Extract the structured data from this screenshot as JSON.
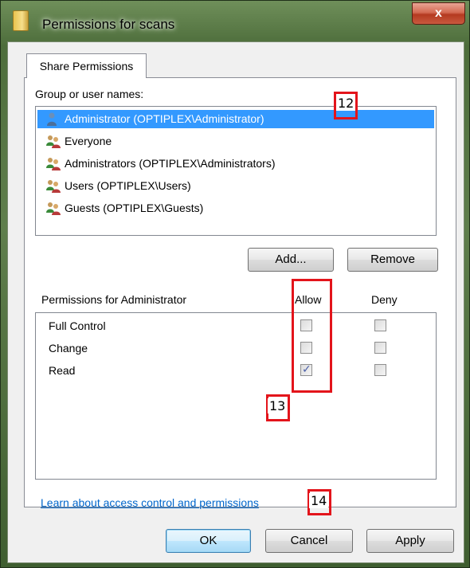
{
  "window": {
    "title": "Permissions for scans",
    "close_glyph": "x"
  },
  "tab": {
    "label": "Share Permissions"
  },
  "group_label": "Group or user names:",
  "users": [
    {
      "name": "Administrator (OPTIPLEX\\Administrator)",
      "icon": "single-user-icon",
      "selected": true
    },
    {
      "name": "Everyone",
      "icon": "user-group-icon",
      "selected": false
    },
    {
      "name": "Administrators (OPTIPLEX\\Administrators)",
      "icon": "user-group-icon",
      "selected": false
    },
    {
      "name": "Users (OPTIPLEX\\Users)",
      "icon": "user-group-icon",
      "selected": false
    },
    {
      "name": "Guests (OPTIPLEX\\Guests)",
      "icon": "user-group-icon",
      "selected": false
    }
  ],
  "buttons": {
    "add": "Add...",
    "remove": "Remove",
    "ok": "OK",
    "cancel": "Cancel",
    "apply": "Apply"
  },
  "permissions": {
    "header": "Permissions for Administrator",
    "allow_label": "Allow",
    "deny_label": "Deny",
    "rows": [
      {
        "name": "Full Control",
        "allow": false,
        "deny": false
      },
      {
        "name": "Change",
        "allow": false,
        "deny": false
      },
      {
        "name": "Read",
        "allow": true,
        "deny": false
      }
    ]
  },
  "link": "Learn about access control and permissions",
  "annotations": [
    "12",
    "13",
    "14"
  ],
  "colors": {
    "selection": "#3399ff",
    "callout": "#e3141b",
    "link": "#0066cc"
  }
}
